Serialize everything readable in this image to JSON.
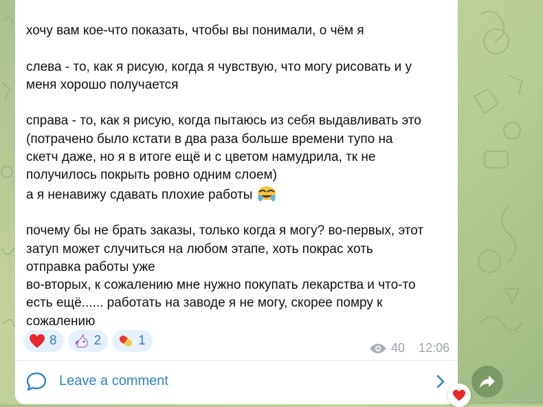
{
  "message": {
    "lines": [
      "хочу вам кое-что показать, чтобы вы понимали, о чём я",
      "",
      "слева - то, как я рисую, когда я чувствую, что могу рисовать и у",
      "меня хорошо получается",
      "",
      "справа - то, как я рисую, когда пытаюсь из себя выдавливать это",
      "(потрачено было кстати в два раза больше времени тупо на",
      "скетч даже, но я в итоге ещё и с цветом намудрила, тк не",
      "получилось покрыть ровно одним слоем)",
      "а я ненавижу сдавать плохие работы",
      "",
      "почему бы не брать заказы, только когда я могу? во-первых, этот",
      "затуп может случиться на любом этапе, хоть покрас хоть",
      "отправка работы уже",
      "во-вторых, к сожалению мне нужно покупать лекарства и что-то",
      "есть ещё...... работать на заводе я не могу, скорее помру к",
      "сожалению"
    ],
    "inline_emoji": "crying-laughing-emoji"
  },
  "reactions": [
    {
      "icon": "heart-icon",
      "count": "8"
    },
    {
      "icon": "unicorn-icon",
      "count": "2"
    },
    {
      "icon": "pill-icon",
      "count": "1"
    }
  ],
  "meta": {
    "views": "40",
    "time": "12:06"
  },
  "comments": {
    "label": "Leave a comment"
  },
  "colors": {
    "accent": "#2f83c9",
    "reaction_bg": "#e7f1fb",
    "meta": "#9aa3ab"
  }
}
